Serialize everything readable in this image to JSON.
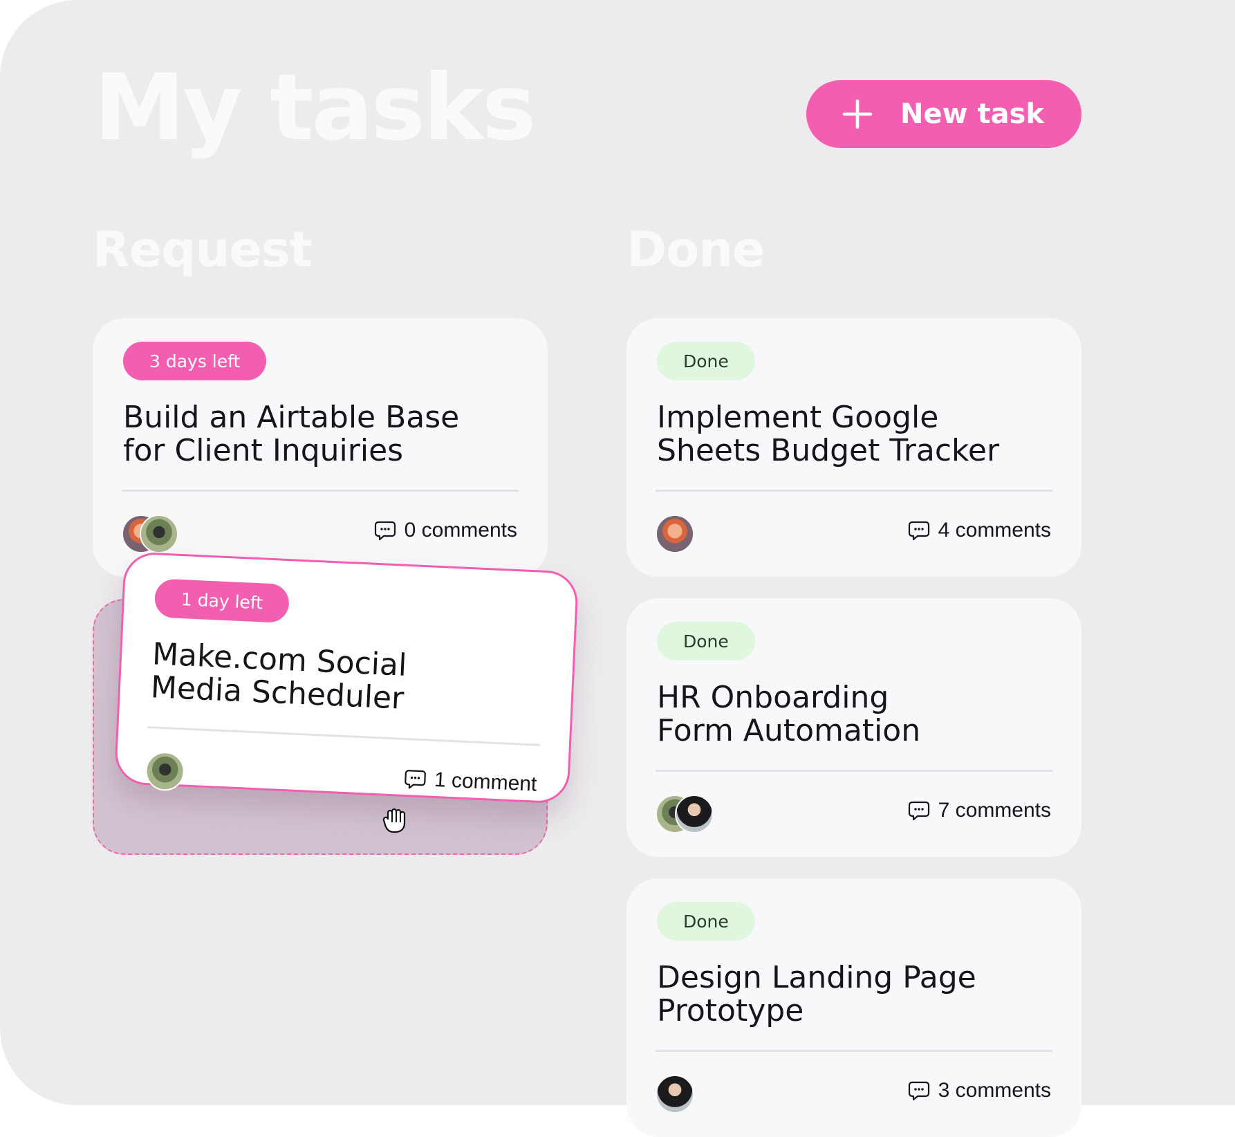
{
  "header": {
    "title": "My tasks",
    "new_task_label": "New task"
  },
  "columns": {
    "request": {
      "title": "Request",
      "cards": [
        {
          "badge": "3 days left",
          "title_lines": [
            "Build an Airtable Base",
            "for Client Inquiries"
          ],
          "comments": "0 comments"
        }
      ],
      "dragging_card": {
        "badge": "1 day left",
        "title_lines": [
          "Make.com Social",
          "Media Scheduler"
        ],
        "comments": "1 comment"
      }
    },
    "done": {
      "title": "Done",
      "cards": [
        {
          "badge": "Done",
          "title_lines": [
            "Implement Google",
            "Sheets Budget Tracker"
          ],
          "comments": "4 comments"
        },
        {
          "badge": "Done",
          "title_lines": [
            "HR Onboarding",
            "Form Automation"
          ],
          "comments": "7 comments"
        },
        {
          "badge": "Done",
          "title_lines": [
            "Design Landing Page",
            "Prototype"
          ],
          "comments": "3 comments"
        }
      ]
    }
  },
  "colors": {
    "accent_pink": "#f25fb0",
    "done_badge_bg": "#dff6df",
    "panel_bg": "#edebed",
    "card_bg": "#f8f8fa"
  },
  "icons": [
    "plus-icon",
    "comment-icon",
    "grab-hand-icon"
  ]
}
